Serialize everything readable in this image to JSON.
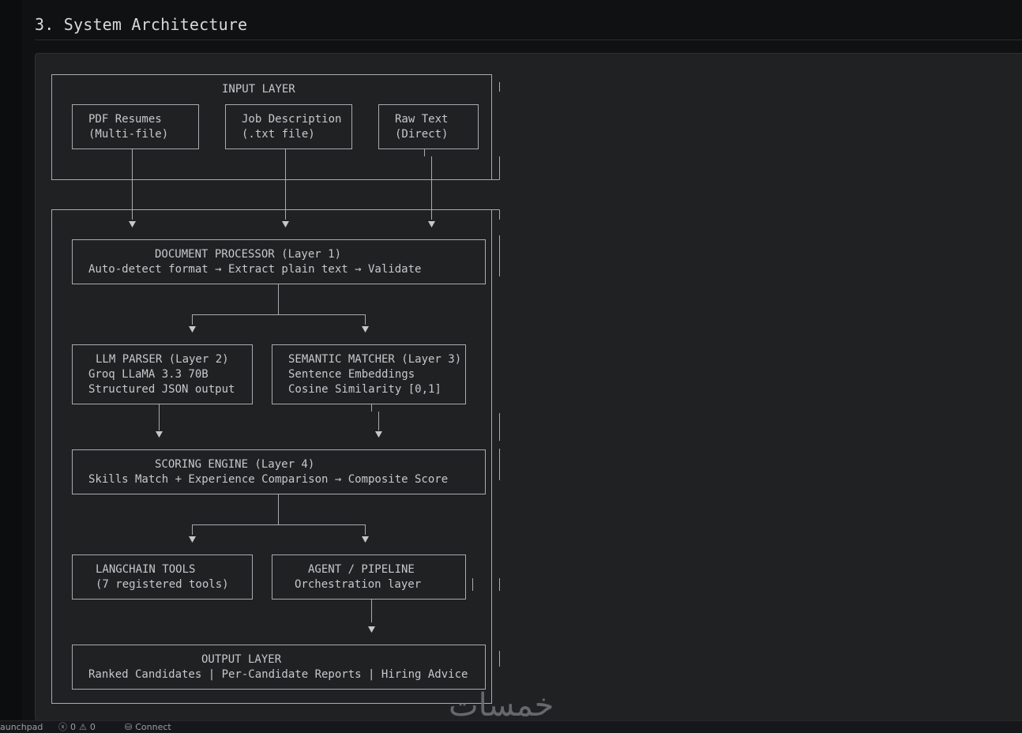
{
  "section": {
    "title": "3. System Architecture"
  },
  "diagram": {
    "input_layer": {
      "title": "INPUT LAYER",
      "sources": [
        {
          "line1": "PDF Resumes",
          "line2": "(Multi-file)"
        },
        {
          "line1": "Job Description",
          "line2": "(.txt file)"
        },
        {
          "line1": "Raw Text",
          "line2": "(Direct)"
        }
      ]
    },
    "document_processor": {
      "title": "DOCUMENT PROCESSOR (Layer 1)",
      "flow": "Auto-detect format → Extract plain text → Validate"
    },
    "llm_parser": {
      "title": "LLM PARSER (Layer 2)",
      "line2": "Groq LLaMA 3.3 70B",
      "line3": "Structured JSON output"
    },
    "semantic_matcher": {
      "title": "SEMANTIC MATCHER (Layer 3)",
      "line2": "Sentence Embeddings",
      "line3": "Cosine Similarity [0,1]"
    },
    "scoring_engine": {
      "title": "SCORING ENGINE (Layer 4)",
      "flow": "Skills Match + Experience Comparison → Composite Score"
    },
    "langchain_tools": {
      "title": "LANGCHAIN TOOLS",
      "line2": "(7 registered tools)"
    },
    "agent_pipeline": {
      "title": "AGENT / PIPELINE",
      "line2": "Orchestration layer"
    },
    "output_layer": {
      "title": "OUTPUT LAYER",
      "line2": "Ranked Candidates | Per-Candidate Reports | Hiring Advice"
    }
  },
  "watermark": {
    "text": "خمسات"
  },
  "statusbar": {
    "launchpad": "aunchpad",
    "errors": "0",
    "warnings": "0",
    "connect": "Connect"
  },
  "icons": {
    "error": "error-circle-icon",
    "warning": "warning-triangle-icon",
    "connect": "database-icon"
  },
  "colors": {
    "page_bg": "#101113",
    "code_bg": "#202123",
    "text": "#c6c8cb",
    "line": "#a9abae"
  }
}
